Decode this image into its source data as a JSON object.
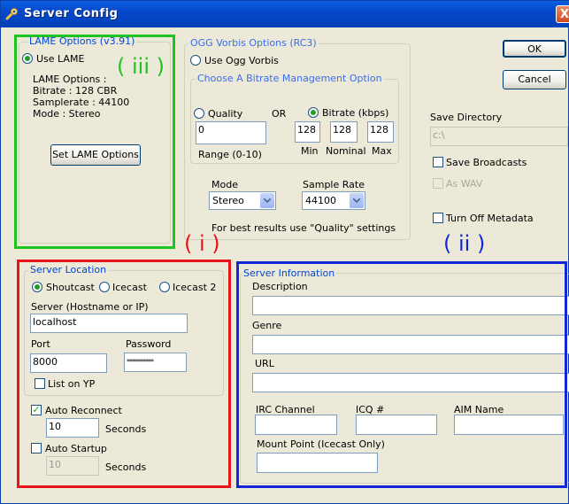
{
  "window": {
    "title": "Server Config",
    "close_glyph": "X"
  },
  "buttons": {
    "ok": "OK",
    "cancel": "Cancel"
  },
  "lame": {
    "legend": "LAME Options (v3.91)",
    "use_label": "Use LAME",
    "info_title": "LAME Options :",
    "bitrate": "Bitrate : 128 CBR",
    "samplerate": "Samplerate : 44100",
    "mode": "Mode : Stereo",
    "set_button": "Set LAME Options"
  },
  "ogg": {
    "legend": "OGG Vorbis Options (RC3)",
    "use_label": "Use Ogg Vorbis",
    "bitrate_legend": "Choose A Bitrate Management Option",
    "quality_label": "Quality",
    "or_label": "OR",
    "bitrate_label": "Bitrate (kbps)",
    "quality_value": "0",
    "range_label": "Range (0-10)",
    "min_value": "128",
    "nominal_value": "128",
    "max_value": "128",
    "min_label": "Min",
    "nominal_label": "Nominal",
    "max_label": "Max",
    "mode_label": "Mode",
    "mode_value": "Stereo",
    "sample_rate_label": "Sample Rate",
    "sample_rate_value": "44100",
    "tip": "For best results use \"Quality\" settings"
  },
  "save": {
    "directory_label": "Save Directory",
    "directory_value": "c:\\",
    "broadcasts_label": "Save Broadcasts",
    "as_wav_label": "As WAV",
    "turn_off_metadata_label": "Turn Off Metadata"
  },
  "server_location": {
    "legend": "Server Location",
    "shoutcast": "Shoutcast",
    "icecast": "Icecast",
    "icecast2": "Icecast 2",
    "server_label": "Server (Hostname or IP)",
    "server_value": "localhost",
    "port_label": "Port",
    "port_value": "8000",
    "password_label": "Password",
    "password_value": "**********",
    "list_on_yp": "List on YP",
    "auto_reconnect": "Auto Reconnect",
    "reconnect_value": "10",
    "seconds": "Seconds",
    "auto_startup": "Auto Startup",
    "startup_value": "10",
    "seconds2": "Seconds"
  },
  "server_info": {
    "legend": "Server Information",
    "description_label": "Description",
    "genre_label": "Genre",
    "url_label": "URL",
    "irc_label": "IRC Channel",
    "icq_label": "ICQ #",
    "aim_label": "AIM Name",
    "mount_label": "Mount Point (Icecast Only)"
  },
  "annotations": {
    "i": "( i )",
    "ii": "( ii )",
    "iii": "( iii )",
    "color_i": "#e8141c",
    "color_ii": "#1228d6",
    "color_iii": "#1fc21f"
  },
  "icons": {
    "title_icon": "wrench-icon",
    "dropdown": "chevron-down-icon"
  }
}
